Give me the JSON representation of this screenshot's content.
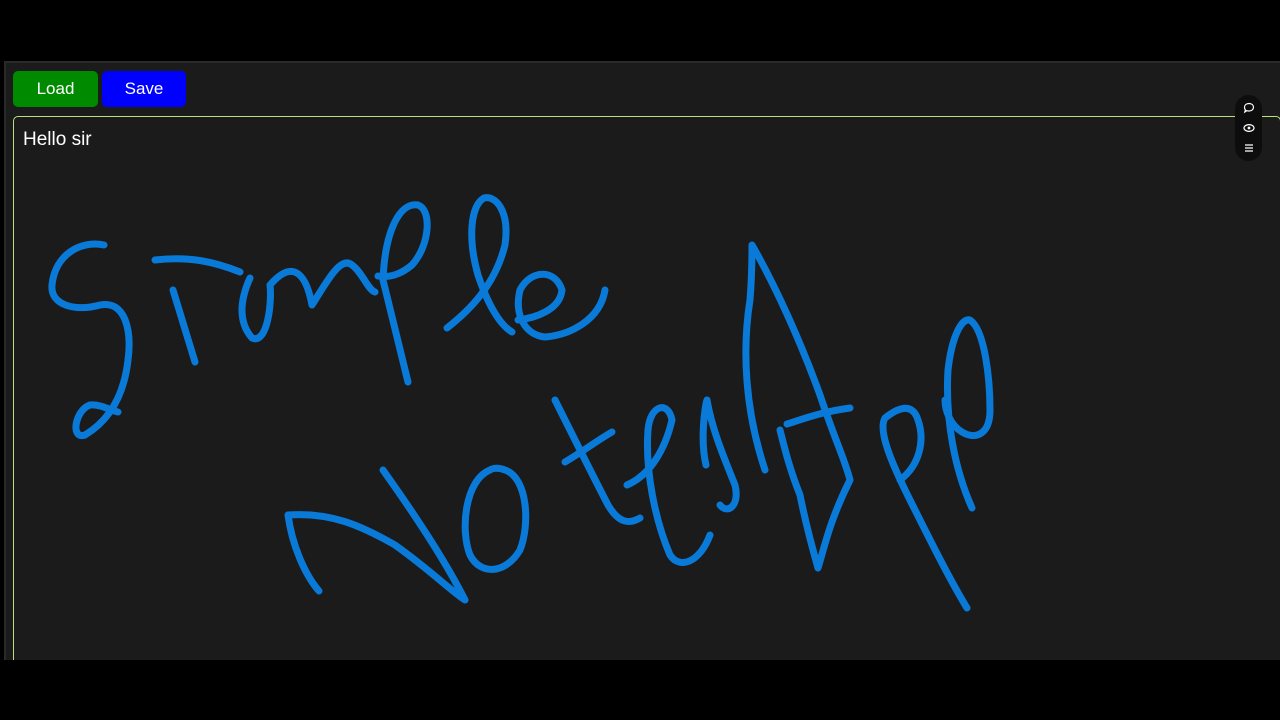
{
  "toolbar": {
    "load_label": "Load",
    "save_label": "Save"
  },
  "note": {
    "text": "Hello sir",
    "handwriting": "Simple Notes App",
    "ink_color": "#0a7ad8"
  },
  "colors": {
    "load_button": "#008a00",
    "save_button": "#0000ff",
    "editor_border": "#b6e27c",
    "background": "#1c1b1c"
  },
  "float_tools": {
    "icons": [
      "comment-icon",
      "eye-icon",
      "menu-icon"
    ]
  }
}
